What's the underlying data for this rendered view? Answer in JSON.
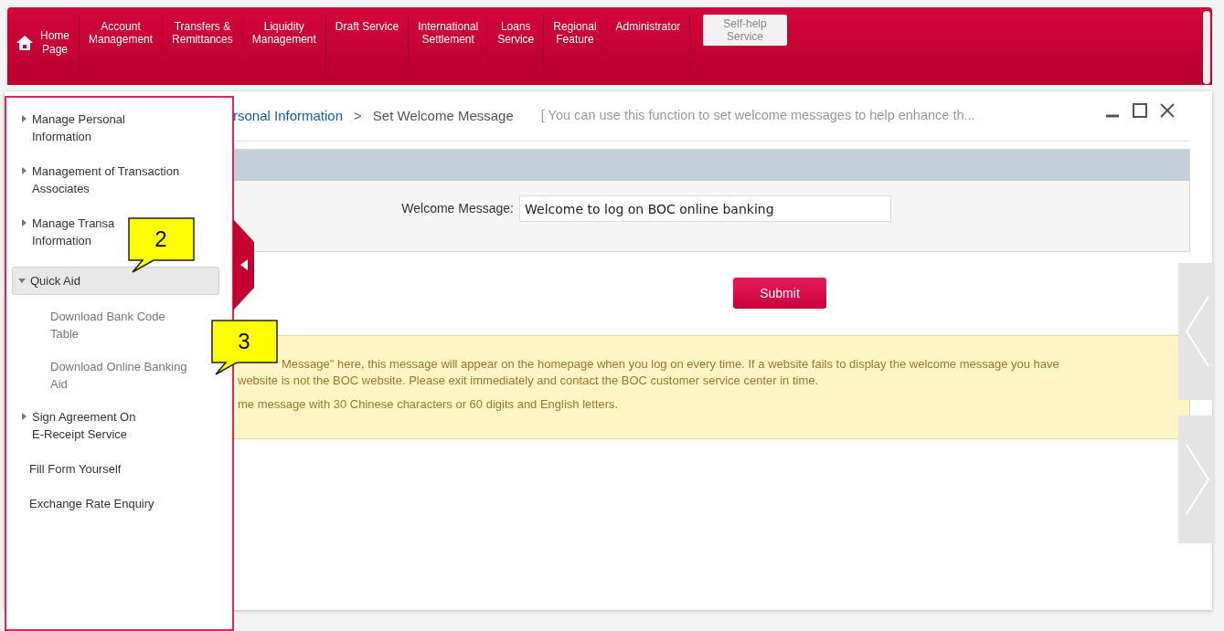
{
  "nav": [
    {
      "label": "Home\nPage",
      "kind": "home",
      "selected": false
    },
    {
      "label": "Account\nManagement",
      "kind": "menu",
      "selected": false
    },
    {
      "label": "Transfers &\nRemittances",
      "kind": "menu",
      "selected": false
    },
    {
      "label": "Liquidity\nManagement",
      "kind": "menu",
      "selected": false
    },
    {
      "label": "Draft Service",
      "kind": "menu",
      "selected": false
    },
    {
      "label": "International\nSettlement",
      "kind": "menu",
      "selected": false
    },
    {
      "label": "Loans\nService",
      "kind": "menu",
      "selected": false
    },
    {
      "label": "Regional\nFeature",
      "kind": "menu",
      "selected": false
    },
    {
      "label": "Administrator",
      "kind": "menu",
      "selected": false
    },
    {
      "label": "Self-help\nService",
      "kind": "menu",
      "selected": true
    }
  ],
  "breadcrumb": {
    "parent": "rsonal Information",
    "separator": ">",
    "current": "Set Welcome Message",
    "hint": "[ You can use this function to set welcome messages to help enhance th..."
  },
  "form": {
    "label": "Welcome Message:",
    "value": "Welcome to log on BOC online banking",
    "submit": "Submit"
  },
  "notice": [
    "Message\" here, this message will appear on the homepage when you log on every time. If a website fails to display the welcome message you have",
    "website is not the BOC website. Please exit immediately and contact the BOC customer service center in time.",
    "me message with 30 Chinese characters or 60 digits and English letters."
  ],
  "sidebar": {
    "items": [
      {
        "label": "Manage Personal\nInformation",
        "expanded": false,
        "selected": false
      },
      {
        "label": "Management of Transaction\nAssociates",
        "expanded": false,
        "selected": false
      },
      {
        "label": "Manage Transa\nInformation",
        "expanded": false,
        "selected": false
      },
      {
        "label": "Quick Aid",
        "expanded": true,
        "selected": true,
        "children": [
          {
            "label": "Download Bank Code\nTable"
          },
          {
            "label": "Download Online Banking\nAid"
          }
        ]
      },
      {
        "label": "Sign Agreement On\nE-Receipt Service",
        "expanded": false,
        "selected": false
      },
      {
        "label": "Fill Form Yourself"
      },
      {
        "label": "Exchange Rate Enquiry"
      }
    ]
  },
  "callouts": [
    {
      "number": "2"
    },
    {
      "number": "3"
    }
  ]
}
